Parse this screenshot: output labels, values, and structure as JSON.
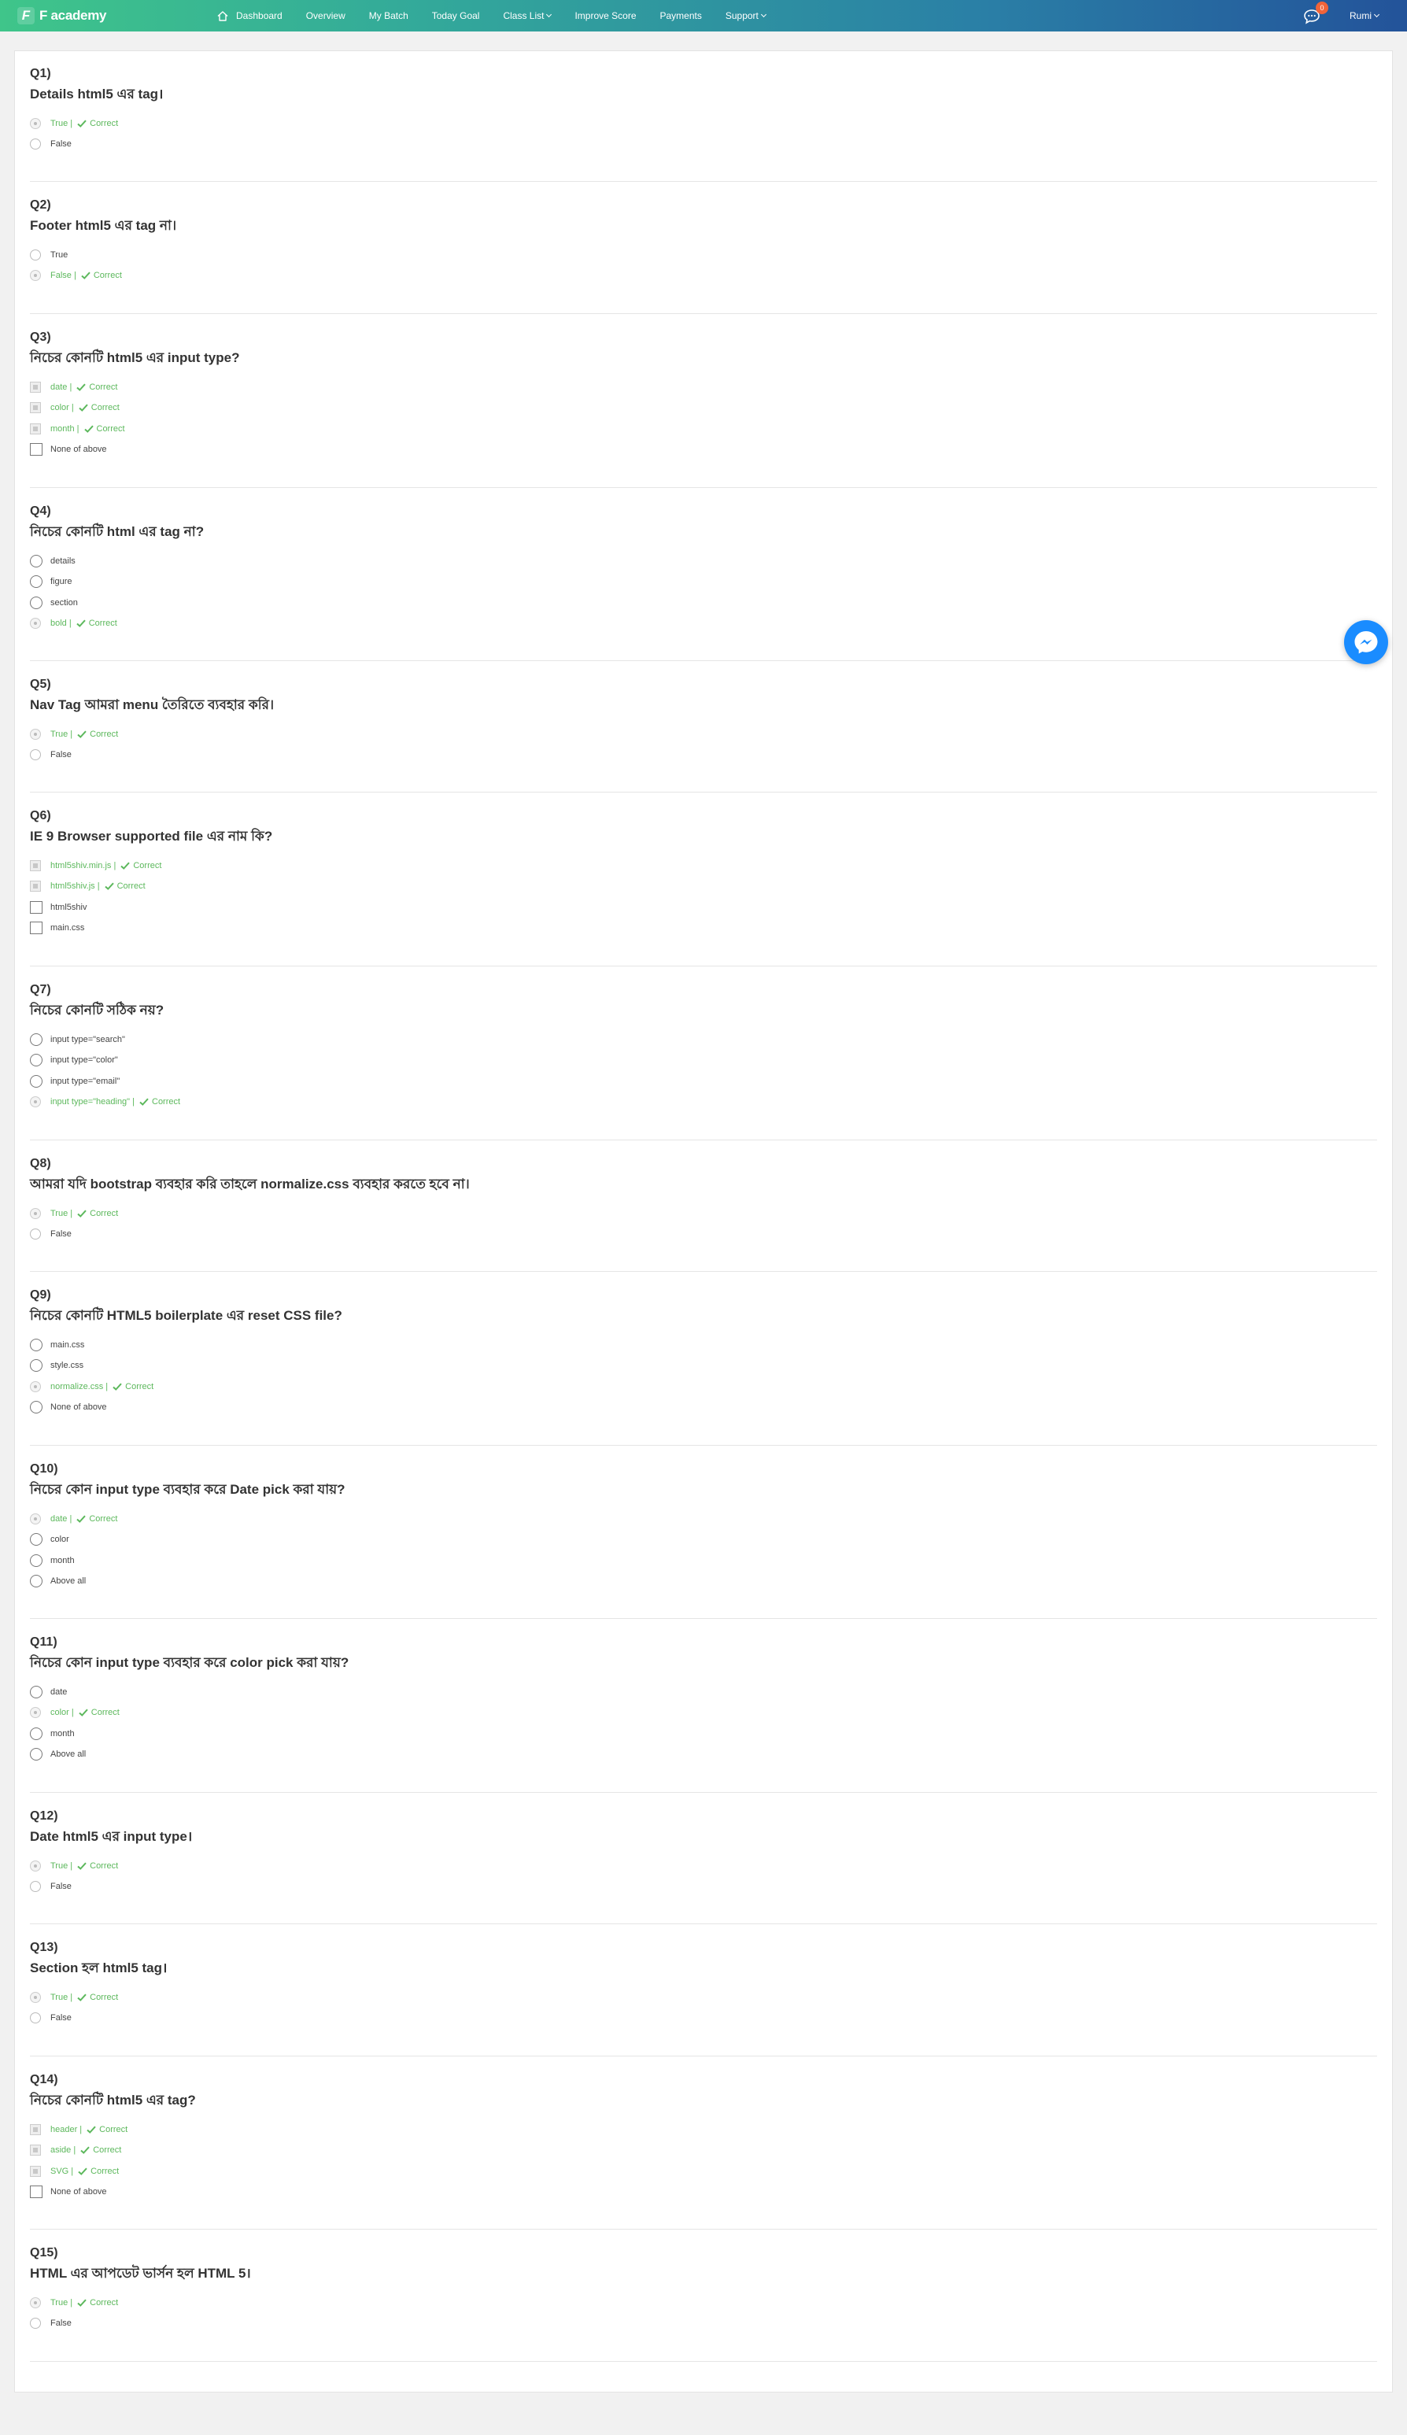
{
  "brand": {
    "logo_letter": "F",
    "name": "F academy"
  },
  "nav": {
    "dashboard": "Dashboard",
    "overview": "Overview",
    "my_batch": "My Batch",
    "today_goal": "Today Goal",
    "class_list": "Class List",
    "improve_score": "Improve Score",
    "payments": "Payments",
    "support": "Support"
  },
  "notifications": {
    "count": "0"
  },
  "user": {
    "name": "Rumi"
  },
  "correct_label": "Correct",
  "colors": {
    "correct": "#5cb85c",
    "nav_start": "#3fc58a",
    "nav_end": "#23539a",
    "messenger": "#1a8cff"
  },
  "questions": [
    {
      "num": "Q1)",
      "text": "Details html5 এর tag।",
      "type": "radio",
      "options": [
        {
          "label": "True |",
          "correct": true
        },
        {
          "label": "False",
          "correct": false
        }
      ]
    },
    {
      "num": "Q2)",
      "text": "Footer html5 এর tag না।",
      "type": "radio",
      "options": [
        {
          "label": "True",
          "correct": false
        },
        {
          "label": "False |",
          "correct": true
        }
      ]
    },
    {
      "num": "Q3)",
      "text": "নিচের কোনটি html5 এর  input type?",
      "type": "checkbox",
      "options": [
        {
          "label": "date |",
          "correct": true
        },
        {
          "label": "color |",
          "correct": true
        },
        {
          "label": "month |",
          "correct": true
        },
        {
          "label": "None of above",
          "correct": false
        }
      ]
    },
    {
      "num": "Q4)",
      "text": "নিচের কোনটি html এর tag না?",
      "type": "radio-big",
      "options": [
        {
          "label": "details",
          "correct": false
        },
        {
          "label": "figure",
          "correct": false
        },
        {
          "label": "section",
          "correct": false
        },
        {
          "label": "bold |",
          "correct": true
        }
      ]
    },
    {
      "num": "Q5)",
      "text": "Nav Tag আমরা menu তৈরিতে ব্যবহার করি।",
      "type": "radio",
      "options": [
        {
          "label": "True |",
          "correct": true
        },
        {
          "label": "False",
          "correct": false
        }
      ]
    },
    {
      "num": "Q6)",
      "text": "IE 9 Browser supported file এর নাম কি?",
      "type": "checkbox",
      "options": [
        {
          "label": "html5shiv.min.js |",
          "correct": true
        },
        {
          "label": "html5shiv.js |",
          "correct": true
        },
        {
          "label": "html5shiv",
          "correct": false
        },
        {
          "label": "main.css",
          "correct": false
        }
      ]
    },
    {
      "num": "Q7)",
      "text": "নিচের কোনটি সঠিক নয়?",
      "type": "radio-big",
      "options": [
        {
          "label": "input type=\"search\"",
          "correct": false
        },
        {
          "label": "input type=\"color\"",
          "correct": false
        },
        {
          "label": "input type=\"email\"",
          "correct": false
        },
        {
          "label": "input type=\"heading\" |",
          "correct": true
        }
      ]
    },
    {
      "num": "Q8)",
      "text": "আমরা যদি bootstrap ব্যবহার করি তাহলে normalize.css ব্যবহার করতে হবে না।",
      "type": "radio",
      "options": [
        {
          "label": "True |",
          "correct": true
        },
        {
          "label": "False",
          "correct": false
        }
      ]
    },
    {
      "num": "Q9)",
      "text": "নিচের কোনটি HTML5 boilerplate এর reset CSS file?",
      "type": "radio-big",
      "options": [
        {
          "label": "main.css",
          "correct": false
        },
        {
          "label": "style.css",
          "correct": false
        },
        {
          "label": "normalize.css |",
          "correct": true
        },
        {
          "label": "None of above",
          "correct": false
        }
      ]
    },
    {
      "num": "Q10)",
      "text": "নিচের কোন input type ব্যবহার করে Date pick  করা যায়?",
      "type": "radio-big",
      "options": [
        {
          "label": "date |",
          "correct": true
        },
        {
          "label": "color",
          "correct": false
        },
        {
          "label": "month",
          "correct": false
        },
        {
          "label": "Above all",
          "correct": false
        }
      ]
    },
    {
      "num": "Q11)",
      "text": "নিচের কোন input type ব্যবহার করে color pick  করা যায়?",
      "type": "radio-big",
      "options": [
        {
          "label": "date",
          "correct": false
        },
        {
          "label": "color |",
          "correct": true
        },
        {
          "label": "month",
          "correct": false
        },
        {
          "label": "Above all",
          "correct": false
        }
      ]
    },
    {
      "num": "Q12)",
      "text": "Date html5 এর input type।",
      "type": "radio",
      "options": [
        {
          "label": "True |",
          "correct": true
        },
        {
          "label": "False",
          "correct": false
        }
      ]
    },
    {
      "num": "Q13)",
      "text": "Section হল html5 tag।",
      "type": "radio",
      "options": [
        {
          "label": "True |",
          "correct": true
        },
        {
          "label": "False",
          "correct": false
        }
      ]
    },
    {
      "num": "Q14)",
      "text": "নিচের কোনটি html5  এর tag?",
      "type": "checkbox",
      "options": [
        {
          "label": "header |",
          "correct": true
        },
        {
          "label": "aside |",
          "correct": true
        },
        {
          "label": "SVG |",
          "correct": true
        },
        {
          "label": "None of above",
          "correct": false
        }
      ]
    },
    {
      "num": "Q15)",
      "text": "HTML এর আপডেট ভার্সন হল HTML 5।",
      "type": "radio",
      "options": [
        {
          "label": "True |",
          "correct": true
        },
        {
          "label": "False",
          "correct": false
        }
      ]
    }
  ]
}
